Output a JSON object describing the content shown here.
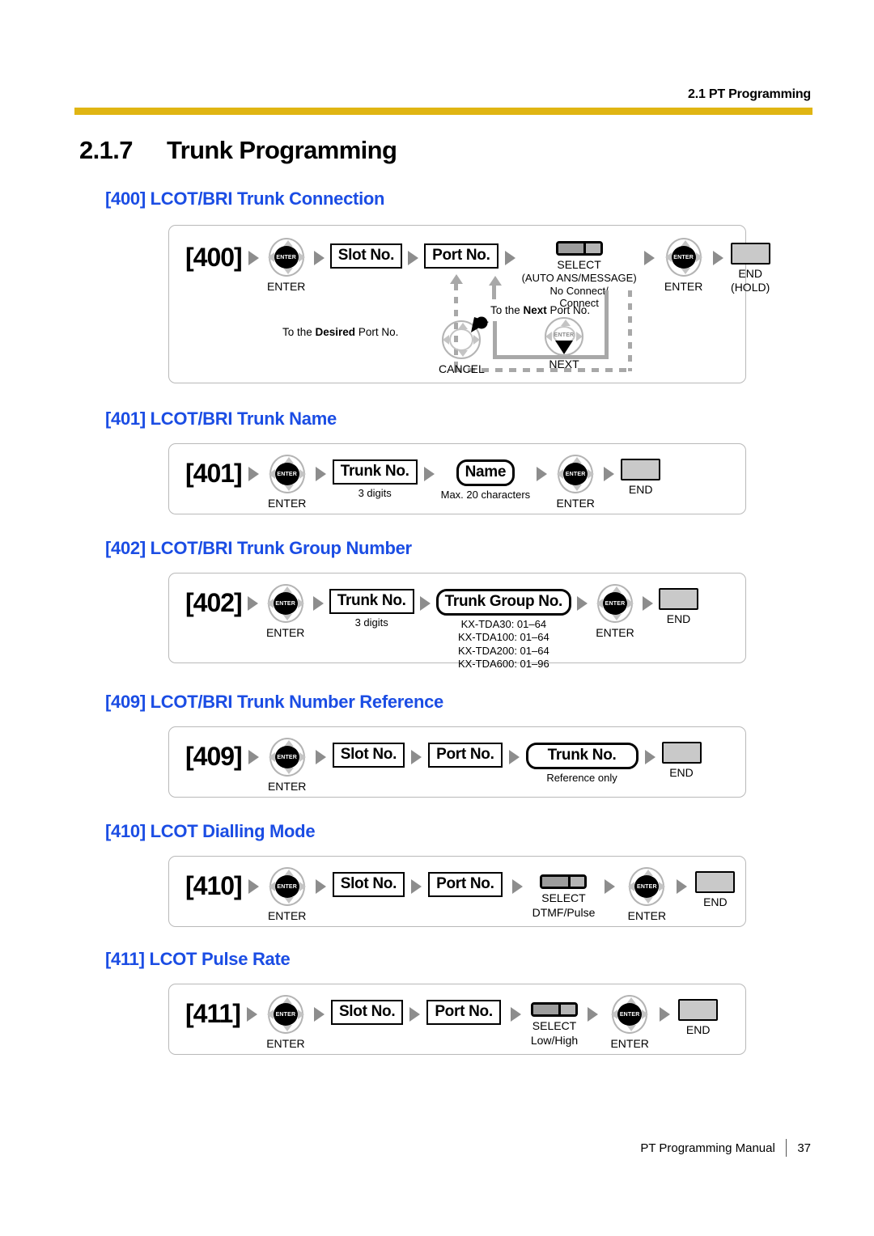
{
  "header": {
    "running_head": "2.1 PT Programming"
  },
  "section": {
    "number": "2.1.7",
    "title": "Trunk Programming"
  },
  "footer": {
    "manual": "PT Programming Manual",
    "page": "37"
  },
  "colors": {
    "heading_blue": "#1B4DE4",
    "rule_gold": "#E0B513",
    "button_gray": "#C9C9C9",
    "connector_gray": "#A8A8A8"
  },
  "common": {
    "enter_label": "ENTER",
    "enter_hub": "ENTER",
    "end_label": "END",
    "select_label": "SELECT",
    "cancel_label": "CANCEL",
    "next_label": "NEXT"
  },
  "programs": [
    {
      "id": "400",
      "heading": "[400] LCOT/BRI Trunk Connection",
      "code": "[400]",
      "steps": [
        {
          "kind": "navigator",
          "name": "enter-key",
          "caption": "ENTER",
          "hub": "ENTER"
        },
        {
          "kind": "box",
          "label": "Slot No.",
          "rounded": false,
          "caption": ""
        },
        {
          "kind": "box",
          "label": "Port No.",
          "rounded": false,
          "caption": ""
        },
        {
          "kind": "select",
          "caption": "SELECT\n(AUTO ANS/MESSAGE)\nNo Connect/\nConnect",
          "caption_lines": [
            "SELECT",
            "(AUTO ANS/MESSAGE)",
            "No Connect/",
            "Connect"
          ]
        },
        {
          "kind": "navigator",
          "name": "enter-key",
          "caption": "ENTER",
          "hub": "ENTER"
        },
        {
          "kind": "end",
          "caption_lines": [
            "END",
            "(HOLD)"
          ]
        }
      ],
      "loops": [
        {
          "name": "cancel-loop",
          "label": "CANCEL",
          "note": "To the Desired Port No.",
          "note_bold": "Desired"
        },
        {
          "name": "next-loop",
          "label": "NEXT",
          "note": "To the Next Port No.",
          "note_bold": "Next"
        }
      ]
    },
    {
      "id": "401",
      "heading": "[401] LCOT/BRI Trunk Name",
      "code": "[401]",
      "steps": [
        {
          "kind": "navigator",
          "name": "enter-key",
          "caption": "ENTER",
          "hub": "ENTER"
        },
        {
          "kind": "box",
          "label": "Trunk No.",
          "rounded": false,
          "caption": "3 digits"
        },
        {
          "kind": "box",
          "label": "Name",
          "rounded": true,
          "caption": "Max. 20 characters"
        },
        {
          "kind": "navigator",
          "name": "enter-key",
          "caption": "ENTER",
          "hub": "ENTER"
        },
        {
          "kind": "end",
          "caption_lines": [
            "END"
          ]
        }
      ]
    },
    {
      "id": "402",
      "heading": "[402] LCOT/BRI Trunk Group Number",
      "code": "[402]",
      "steps": [
        {
          "kind": "navigator",
          "name": "enter-key",
          "caption": "ENTER",
          "hub": "ENTER"
        },
        {
          "kind": "box",
          "label": "Trunk No.",
          "rounded": false,
          "caption": "3 digits"
        },
        {
          "kind": "box",
          "label": "Trunk Group No.",
          "rounded": true,
          "caption_lines": [
            "KX-TDA30: 01–64",
            "KX-TDA100: 01–64",
            "KX-TDA200: 01–64",
            "KX-TDA600: 01–96"
          ]
        },
        {
          "kind": "navigator",
          "name": "enter-key",
          "caption": "ENTER",
          "hub": "ENTER"
        },
        {
          "kind": "end",
          "caption_lines": [
            "END"
          ]
        }
      ]
    },
    {
      "id": "409",
      "heading": "[409] LCOT/BRI Trunk Number Reference",
      "code": "[409]",
      "steps": [
        {
          "kind": "navigator",
          "name": "enter-key",
          "caption": "ENTER",
          "hub": "ENTER"
        },
        {
          "kind": "box",
          "label": "Slot No.",
          "rounded": false,
          "caption": ""
        },
        {
          "kind": "box",
          "label": "Port No.",
          "rounded": false,
          "caption": ""
        },
        {
          "kind": "box",
          "label": "Trunk No.",
          "rounded": true,
          "caption": "Reference only"
        },
        {
          "kind": "end",
          "caption_lines": [
            "END"
          ]
        }
      ]
    },
    {
      "id": "410",
      "heading": "[410] LCOT Dialling Mode",
      "code": "[410]",
      "steps": [
        {
          "kind": "navigator",
          "name": "enter-key",
          "caption": "ENTER",
          "hub": "ENTER"
        },
        {
          "kind": "box",
          "label": "Slot No.",
          "rounded": false,
          "caption": ""
        },
        {
          "kind": "box",
          "label": "Port No.",
          "rounded": false,
          "caption": ""
        },
        {
          "kind": "select",
          "caption_lines": [
            "SELECT",
            "DTMF/Pulse"
          ]
        },
        {
          "kind": "navigator",
          "name": "enter-key",
          "caption": "ENTER",
          "hub": "ENTER"
        },
        {
          "kind": "end",
          "caption_lines": [
            "END"
          ]
        }
      ]
    },
    {
      "id": "411",
      "heading": "[411] LCOT Pulse Rate",
      "code": "[411]",
      "steps": [
        {
          "kind": "navigator",
          "name": "enter-key",
          "caption": "ENTER",
          "hub": "ENTER"
        },
        {
          "kind": "box",
          "label": "Slot No.",
          "rounded": false,
          "caption": ""
        },
        {
          "kind": "box",
          "label": "Port No.",
          "rounded": false,
          "caption": ""
        },
        {
          "kind": "select",
          "caption_lines": [
            "SELECT",
            "Low/High"
          ]
        },
        {
          "kind": "navigator",
          "name": "enter-key",
          "caption": "ENTER",
          "hub": "ENTER"
        },
        {
          "kind": "end",
          "caption_lines": [
            "END"
          ]
        }
      ]
    }
  ]
}
